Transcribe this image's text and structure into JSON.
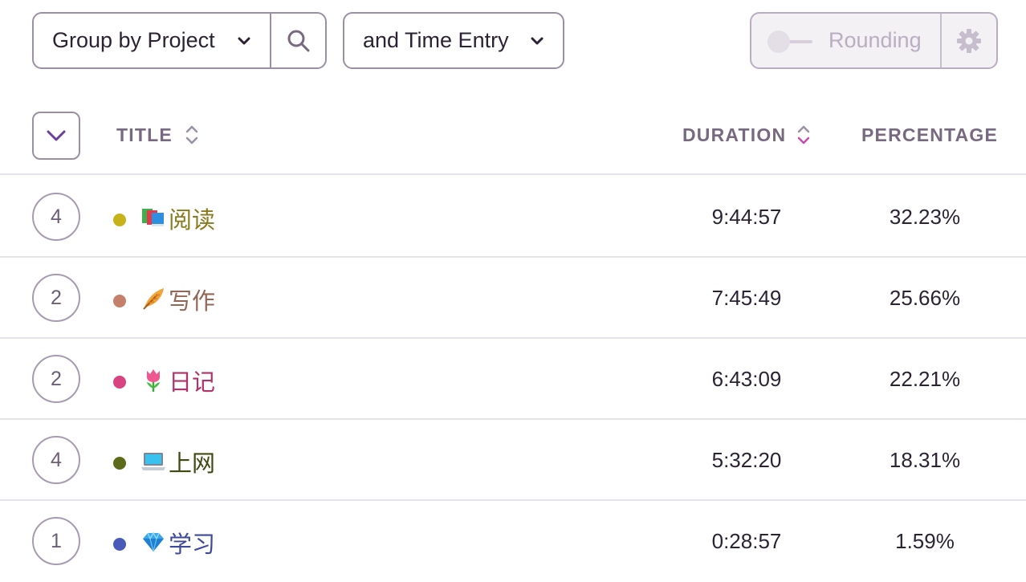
{
  "toolbar": {
    "group_by_label": "Group by Project",
    "sub_group_label": "and Time Entry",
    "rounding_label": "Rounding",
    "search_icon": "search-icon",
    "settings_icon": "gear-icon"
  },
  "table": {
    "columns": {
      "title": "TITLE",
      "duration": "DURATION",
      "percentage": "PERCENTAGE"
    },
    "sorted_by": "duration",
    "rows": [
      {
        "count": "4",
        "color": "#c8b21a",
        "emoji": "books",
        "title": "阅读",
        "title_color": "#8a7a1c",
        "duration": "9:44:57",
        "percentage": "32.23%"
      },
      {
        "count": "2",
        "color": "#c4806a",
        "emoji": "feather",
        "title": "写作",
        "title_color": "#946656",
        "duration": "7:45:49",
        "percentage": "25.66%"
      },
      {
        "count": "2",
        "color": "#d9437f",
        "emoji": "tulip",
        "title": "日记",
        "title_color": "#b2336a",
        "duration": "6:43:09",
        "percentage": "22.21%"
      },
      {
        "count": "4",
        "color": "#5c6a1a",
        "emoji": "laptop",
        "title": "上网",
        "title_color": "#3f4a12",
        "duration": "5:32:20",
        "percentage": "18.31%"
      },
      {
        "count": "1",
        "color": "#4a5ab8",
        "emoji": "gem",
        "title": "学习",
        "title_color": "#3d4a9c",
        "duration": "0:28:57",
        "percentage": "1.59%"
      }
    ]
  }
}
